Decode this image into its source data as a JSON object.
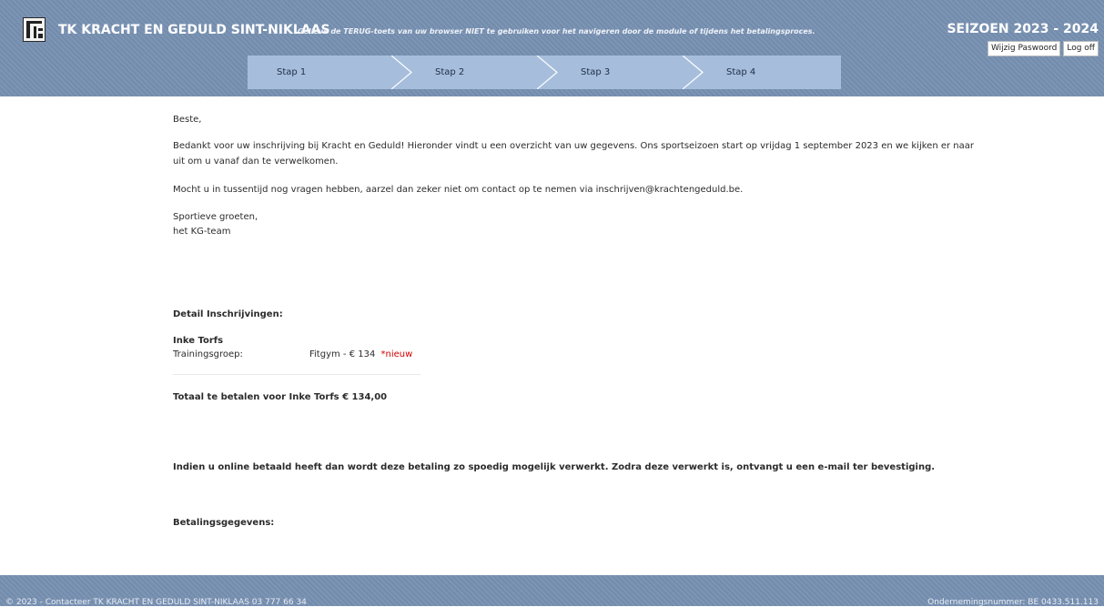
{
  "header": {
    "club_name": "TK KRACHT EN GEDULD SINT-NIKLAAS",
    "notice": "Gelieve de TERUG-toets van uw browser NIET te gebruiken voor het navigeren door de module of tijdens het betalingsproces.",
    "season": "SEIZOEN 2023 - 2024",
    "change_password": "Wijzig Paswoord",
    "logoff": "Log off"
  },
  "steps": [
    {
      "label": "Stap 1",
      "active": true
    },
    {
      "label": "Stap 2",
      "active": false
    },
    {
      "label": "Stap 3",
      "active": false
    },
    {
      "label": "Stap 4",
      "active": false
    }
  ],
  "letter": {
    "greeting": "Beste,",
    "para1_line1": "Bedankt voor uw inschrijving bij Kracht en Geduld! Hieronder vindt u een overzicht van uw gegevens. Ons sportseizoen start op vrijdag 1 september 2023 en we kijken er naar",
    "para1_line2": "uit om u vanaf dan te verwelkomen.",
    "para2": "Mocht u in tussentijd nog vragen hebben, aarzel dan zeker niet om contact op te nemen via inschrijven@krachtengeduld.be.",
    "closing1": "Sportieve groeten,",
    "closing2": "het KG-team"
  },
  "details": {
    "heading": "Detail Inschrijvingen:",
    "member_name": "Inke Torfs",
    "group_label": "Trainingsgroep:",
    "group_value": "Fitgym - € 134",
    "group_new": "*nieuw",
    "total": "Totaal te betalen voor Inke Torfs € 134,00"
  },
  "payment_note": "Indien u online betaald heeft dan wordt deze betaling zo spoedig mogelijk verwerkt. Zodra deze verwerkt is, ontvangt u een e-mail ter bevestiging.",
  "payment_heading": "Betalingsgegevens:",
  "footer": {
    "left": "© 2023 - Contacteer TK KRACHT EN GEDULD SINT-NIKLAAS 03 777 66 34",
    "right": "Ondernemingsnummer: BE 0433.511.113"
  }
}
